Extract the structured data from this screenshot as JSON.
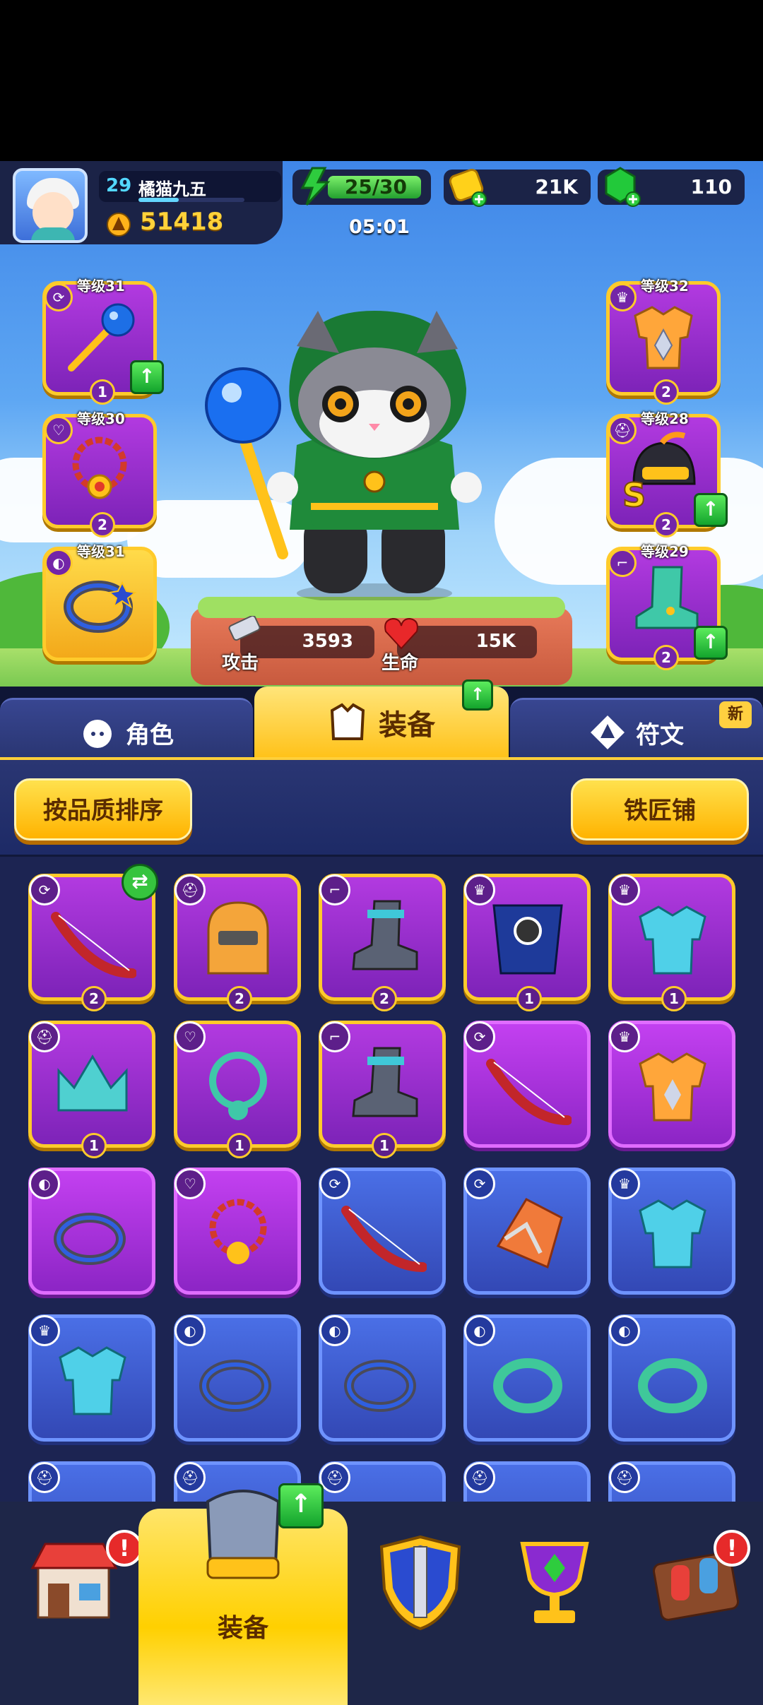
{
  "player": {
    "level": "29",
    "name": "橘猫九五",
    "power": "51418"
  },
  "resources": {
    "energy": "25/30",
    "timer": "05:01",
    "gold": "21K",
    "gems": "110"
  },
  "equipped_left": [
    {
      "level_label": "等级31",
      "star": "1",
      "upgrade": true
    },
    {
      "level_label": "等级30",
      "star": "2",
      "upgrade": false
    },
    {
      "level_label": "等级31",
      "star": "",
      "upgrade": false
    }
  ],
  "equipped_right": [
    {
      "level_label": "等级32",
      "star": "2",
      "upgrade": false
    },
    {
      "level_label": "等级28",
      "star": "2",
      "upgrade": true
    },
    {
      "level_label": "等级29",
      "star": "2",
      "upgrade": true
    }
  ],
  "stats": {
    "attack_label": "攻击",
    "attack": "3593",
    "hp_label": "生命",
    "hp": "15K"
  },
  "tabs": {
    "role": "角色",
    "equip": "装备",
    "rune": "符文",
    "new_badge": "新"
  },
  "actions": {
    "sort": "按品质排序",
    "smith": "铁匠铺"
  },
  "inventory": {
    "row1": [
      "2",
      "2",
      "2",
      "1",
      "1"
    ],
    "row2": [
      "1",
      "1",
      "1",
      "",
      ""
    ]
  },
  "nav": {
    "equip_label": "装备",
    "alert": "!"
  },
  "colors": {
    "purple": "#9a2fd0",
    "blue": "#3a57cf",
    "gold": "#ffcb2b",
    "green": "#2ca52c"
  }
}
